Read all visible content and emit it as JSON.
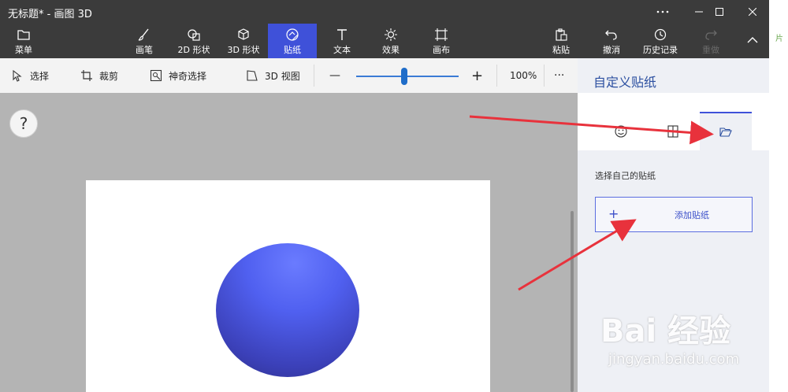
{
  "window": {
    "title": "无标题* - 画图 3D",
    "controls": {
      "menu_icon": "ellipsis-icon",
      "minimize_icon": "minimize-icon",
      "maximize_icon": "maximize-icon",
      "close_icon": "close-icon"
    }
  },
  "ribbon": {
    "menu_label": "菜单",
    "tools": [
      {
        "label": "画笔",
        "icon": "brush-icon"
      },
      {
        "label": "2D 形状",
        "icon": "shapes-2d-icon"
      },
      {
        "label": "3D 形状",
        "icon": "cube-icon"
      },
      {
        "label": "贴纸",
        "icon": "sticker-icon",
        "active": true
      },
      {
        "label": "文本",
        "icon": "text-icon"
      },
      {
        "label": "效果",
        "icon": "effects-icon"
      },
      {
        "label": "画布",
        "icon": "canvas-icon"
      }
    ],
    "right": [
      {
        "label": "粘贴",
        "icon": "paste-icon"
      },
      {
        "label": "撤消",
        "icon": "undo-icon"
      },
      {
        "label": "历史记录",
        "icon": "history-icon"
      },
      {
        "label": "重做",
        "icon": "redo-icon",
        "disabled": true
      }
    ],
    "collapse_icon": "chevron-up-icon"
  },
  "toolbar": {
    "select_label": "选择",
    "crop_label": "裁剪",
    "magic_select_label": "神奇选择",
    "view3d_label": "3D 视图",
    "zoom_out": "—",
    "zoom_in": "+",
    "zoom_level": "100%",
    "more": "···",
    "zoom_fraction": 0.47
  },
  "workspace": {
    "help_label": "?"
  },
  "panel": {
    "title": "自定义贴纸",
    "tabs": [
      {
        "icon": "sticker-face-icon"
      },
      {
        "icon": "texture-icon"
      },
      {
        "icon": "folder-open-icon",
        "active": true
      }
    ],
    "section_label": "选择自己的贴纸",
    "add_plus": "+",
    "add_label": "添加贴纸"
  },
  "side_fragment": "片",
  "watermark": {
    "brand": "Bai  经验",
    "url": "jingyan.baidu.com"
  },
  "colors": {
    "accent": "#3f51d9",
    "chrome": "#3b3b3b",
    "arrow": "#e8323c"
  }
}
